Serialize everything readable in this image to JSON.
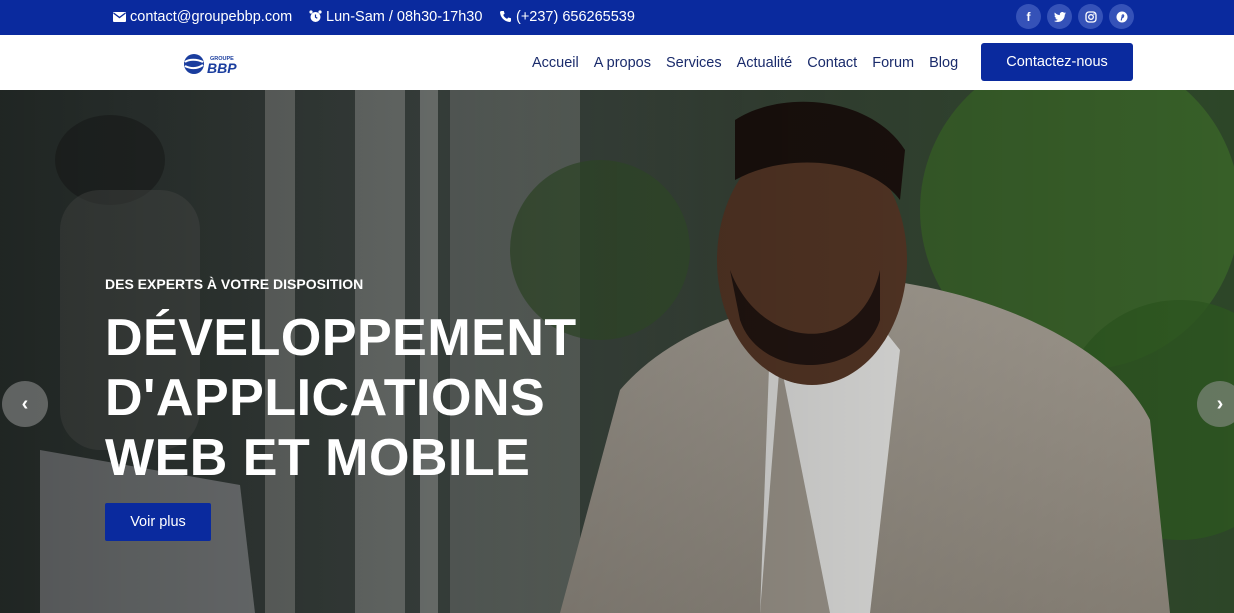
{
  "topbar": {
    "email": "contact@groupebbp.com",
    "hours": "Lun-Sam / 08h30-17h30",
    "phone": "(+237) 656265539",
    "socials": [
      {
        "icon": "facebook-icon",
        "glyph": "f"
      },
      {
        "icon": "twitter-icon",
        "glyph": "t"
      },
      {
        "icon": "instagram-icon",
        "glyph": "ig"
      },
      {
        "icon": "pinterest-icon",
        "glyph": "p"
      }
    ]
  },
  "header": {
    "logo": {
      "small_text": "GROUPE",
      "big_text": "BBP"
    },
    "nav": [
      "Accueil",
      "A propos",
      "Services",
      "Actualité",
      "Contact",
      "Forum",
      "Blog"
    ],
    "cta_label": "Contactez-nous"
  },
  "hero": {
    "eyebrow": "DES EXPERTS À VOTRE DISPOSITION",
    "title_lines": [
      "DÉVELOPPEMENT",
      "D'APPLICATIONS",
      "WEB ET MOBILE"
    ],
    "button_label": "Voir plus",
    "prev_arrow": "‹",
    "next_arrow": "›"
  },
  "colors": {
    "primary": "#0a2a9e",
    "nav_text": "#1a2b6b",
    "white": "#ffffff"
  }
}
